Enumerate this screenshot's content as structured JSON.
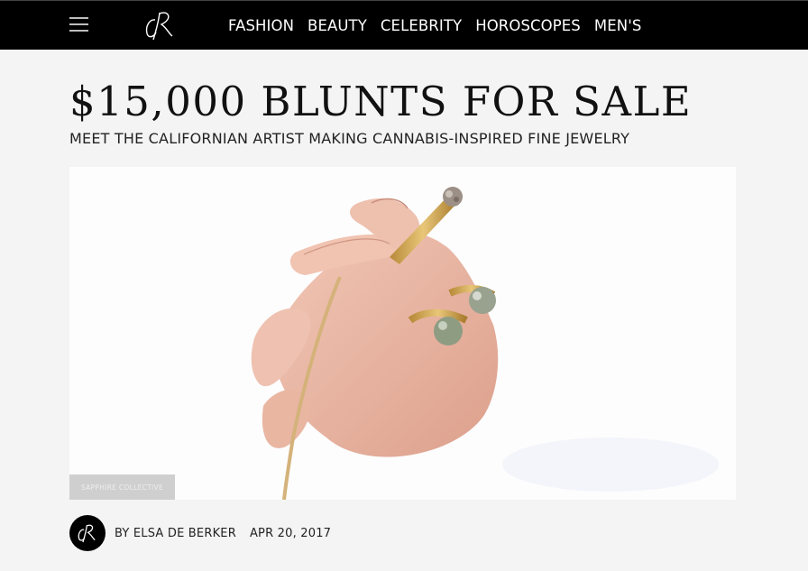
{
  "header": {
    "nav": [
      "FASHION",
      "BEAUTY",
      "CELEBRITY",
      "HOROSCOPES",
      "MEN'S"
    ]
  },
  "article": {
    "title": "$15,000 BLUNTS FOR SALE",
    "subtitle": "MEET THE CALIFORNIAN ARTIST MAKING CANNABIS-INSPIRED FINE JEWELRY",
    "image_credit": "SAPPHIRE COLLECTIVE",
    "author": "BY ELSA DE BERKER",
    "date": "APR 20, 2017"
  },
  "colors": {
    "topbar": "#000000",
    "page_background": "#f4f4f4",
    "text": "#111111"
  },
  "icons": {
    "menu": "hamburger-menu-icon",
    "logo": "cr-script-logo",
    "avatar": "cr-monogram-avatar"
  }
}
